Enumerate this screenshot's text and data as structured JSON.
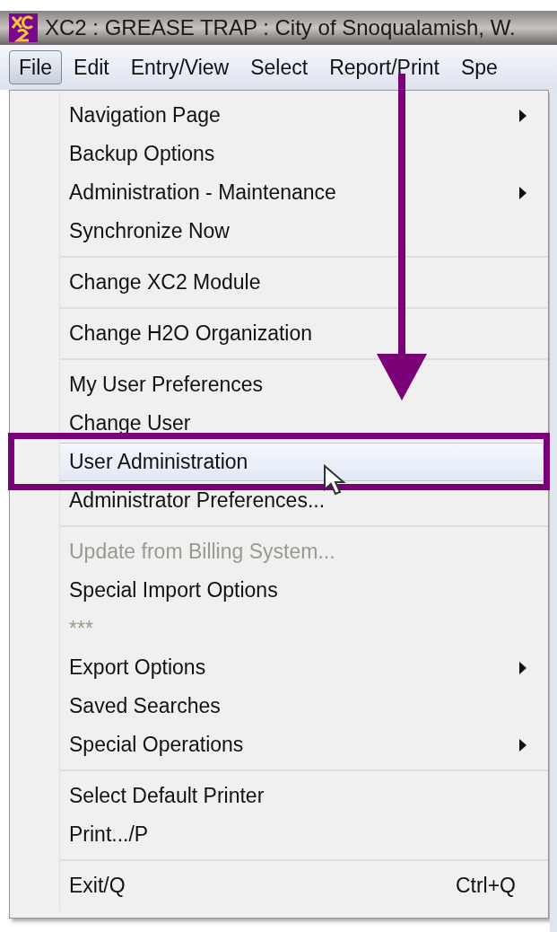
{
  "window": {
    "title": "XC2 : GREASE TRAP : City of Snoqualamish, W."
  },
  "menubar": [
    {
      "label": "File",
      "selected": true
    },
    {
      "label": "Edit",
      "selected": false
    },
    {
      "label": "Entry/View",
      "selected": false
    },
    {
      "label": "Select",
      "selected": false
    },
    {
      "label": "Report/Print",
      "selected": false
    },
    {
      "label": "Spe",
      "selected": false
    }
  ],
  "menu": {
    "groups": [
      [
        {
          "label": "Navigation Page",
          "submenu": true,
          "disabled": false,
          "selected": false
        },
        {
          "label": "Backup Options",
          "submenu": false,
          "disabled": false,
          "selected": false
        },
        {
          "label": "Administration - Maintenance",
          "submenu": true,
          "disabled": false,
          "selected": false
        },
        {
          "label": "Synchronize Now",
          "submenu": false,
          "disabled": false,
          "selected": false
        }
      ],
      [
        {
          "label": "Change XC2 Module",
          "submenu": false,
          "disabled": false,
          "selected": false
        }
      ],
      [
        {
          "label": "Change H2O Organization",
          "submenu": false,
          "disabled": false,
          "selected": false
        }
      ],
      [
        {
          "label": "My User Preferences",
          "submenu": false,
          "disabled": false,
          "selected": false
        },
        {
          "label": "Change User",
          "submenu": false,
          "disabled": false,
          "selected": false
        },
        {
          "label": "User Administration",
          "submenu": false,
          "disabled": false,
          "selected": true
        },
        {
          "label": "Administrator Preferences...",
          "submenu": false,
          "disabled": false,
          "selected": false
        }
      ],
      [
        {
          "label": "Update from Billing System...",
          "submenu": false,
          "disabled": true,
          "selected": false
        },
        {
          "label": "Special Import Options",
          "submenu": false,
          "disabled": false,
          "selected": false
        },
        {
          "label": "***",
          "submenu": false,
          "disabled": true,
          "selected": false
        },
        {
          "label": "Export Options",
          "submenu": true,
          "disabled": false,
          "selected": false
        },
        {
          "label": "Saved Searches",
          "submenu": false,
          "disabled": false,
          "selected": false
        },
        {
          "label": "Special Operations",
          "submenu": true,
          "disabled": false,
          "selected": false
        }
      ],
      [
        {
          "label": "Select Default Printer",
          "submenu": false,
          "disabled": false,
          "selected": false
        },
        {
          "label": "Print.../P",
          "submenu": false,
          "disabled": false,
          "selected": false
        }
      ],
      [
        {
          "label": "Exit/Q",
          "shortcut": "Ctrl+Q",
          "submenu": false,
          "disabled": false,
          "selected": false
        }
      ]
    ]
  }
}
